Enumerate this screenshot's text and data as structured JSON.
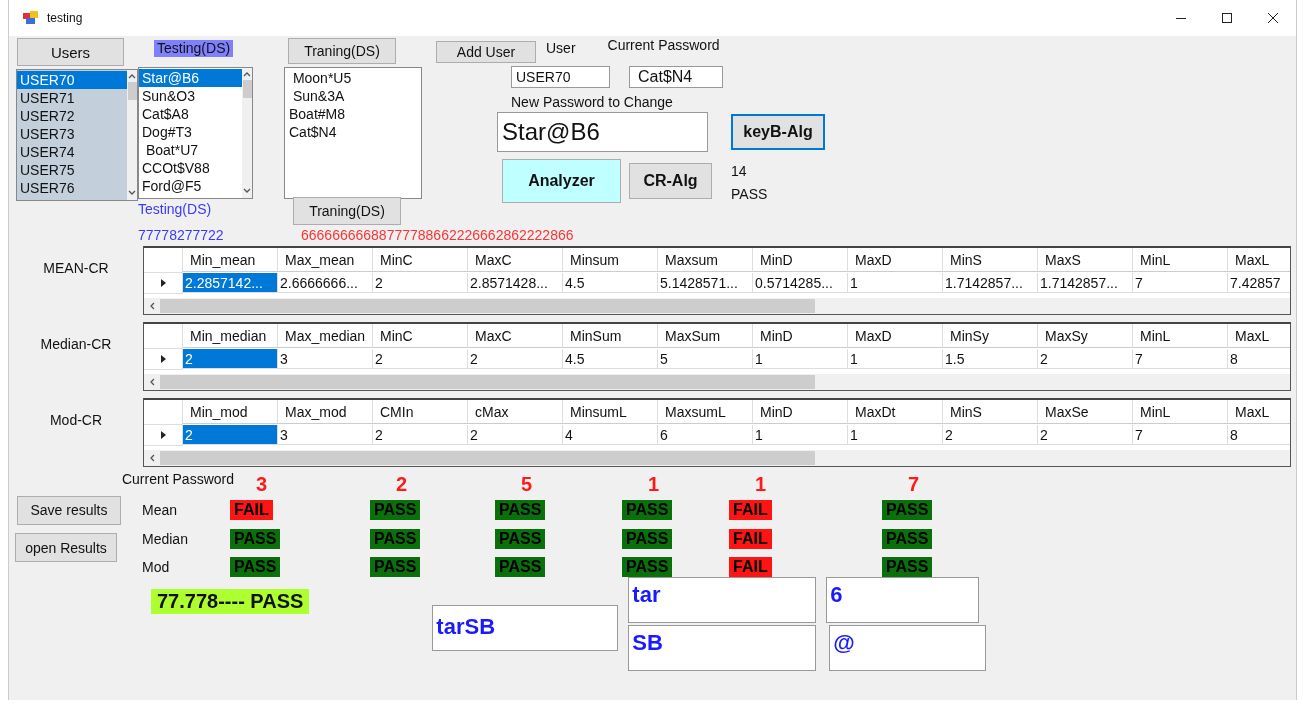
{
  "window": {
    "title": "testing"
  },
  "users_button": "Users",
  "users_list": [
    {
      "label": "USER70",
      "selected": true
    },
    {
      "label": "USER71",
      "selected": false
    },
    {
      "label": "USER72",
      "selected": false
    },
    {
      "label": "USER73",
      "selected": false
    },
    {
      "label": "USER74",
      "selected": false
    },
    {
      "label": "USER75",
      "selected": false
    },
    {
      "label": "USER76",
      "selected": false
    }
  ],
  "testing_heading": "Testing(DS)",
  "testing_list": [
    {
      "label": "Star@B6",
      "selected": true
    },
    {
      "label": "Sun&O3",
      "selected": false
    },
    {
      "label": "Cat$A8",
      "selected": false
    },
    {
      "label": "Dog#T3",
      "selected": false
    },
    {
      "label": " Boat*U7",
      "selected": false
    },
    {
      "label": "CCOt$V88",
      "selected": false
    },
    {
      "label": "Ford@F5",
      "selected": false
    }
  ],
  "training_button": "Traning(DS)",
  "training_list": [
    {
      "label": " Moon*U5",
      "selected": false
    },
    {
      "label": " Sun&3A",
      "selected": false
    },
    {
      "label": "Boat#M8",
      "selected": false
    },
    {
      "label": "Cat$N4",
      "selected": false
    }
  ],
  "testing_caption": "Testing(DS)",
  "training_button_lower": "Traning(DS)",
  "testing_code": "77778277722",
  "training_code": "66666666688777788662226662862222866",
  "add_user_button": "Add User",
  "user_label": "User",
  "current_password_label": "Current Password",
  "user_field": "USER70",
  "current_password_field": "Cat$N4",
  "new_password_label": "New Password to Change",
  "new_password_field": "Star@B6",
  "keyb_button": {
    "label": "keyB-Alg",
    "focused": true
  },
  "analyzer_button": "Analyzer",
  "cr_button": "CR-Alg",
  "length": "14",
  "verdict": "PASS",
  "grids": [
    {
      "label": "MEAN-CR",
      "columns": [
        "Min_mean",
        "Max_mean",
        "MinC",
        "MaxC",
        "Minsum",
        "Maxsum",
        "MinD",
        "MaxD",
        "MinS",
        "MaxS",
        "MinL",
        "MaxL"
      ],
      "cells": [
        {
          "text": "2.2857142...",
          "selected": true
        },
        {
          "text": "2.6666666...",
          "selected": false
        },
        {
          "text": "2",
          "selected": false
        },
        {
          "text": "2.8571428...",
          "selected": false
        },
        {
          "text": "4.5",
          "selected": false
        },
        {
          "text": "5.1428571...",
          "selected": false
        },
        {
          "text": "0.5714285...",
          "selected": false
        },
        {
          "text": "1",
          "selected": false
        },
        {
          "text": "1.7142857...",
          "selected": false
        },
        {
          "text": "1.7142857...",
          "selected": false
        },
        {
          "text": "7",
          "selected": false
        },
        {
          "text": "7.42857",
          "selected": false
        }
      ]
    },
    {
      "label": "Median-CR",
      "columns": [
        "Min_median",
        "Max_median",
        "MinC",
        "MaxC",
        "MinSum",
        "MaxSum",
        "MinD",
        "MaxD",
        "MinSy",
        "MaxSy",
        "MinL",
        "MaxL"
      ],
      "cells": [
        {
          "text": "2",
          "selected": true
        },
        {
          "text": "3",
          "selected": false
        },
        {
          "text": "2",
          "selected": false
        },
        {
          "text": "2",
          "selected": false
        },
        {
          "text": "4.5",
          "selected": false
        },
        {
          "text": "5",
          "selected": false
        },
        {
          "text": "1",
          "selected": false
        },
        {
          "text": "1",
          "selected": false
        },
        {
          "text": "1.5",
          "selected": false
        },
        {
          "text": "2",
          "selected": false
        },
        {
          "text": "7",
          "selected": false
        },
        {
          "text": "8",
          "selected": false
        }
      ]
    },
    {
      "label": "Mod-CR",
      "columns": [
        "Min_mod",
        "Max_mod",
        "CMIn",
        "cMax",
        "MinsumL",
        "MaxsumL",
        "MinD",
        "MaxDt",
        "MinS",
        "MaxSe",
        "MinL",
        "MaxL"
      ],
      "cells": [
        {
          "text": "2",
          "selected": true
        },
        {
          "text": "3",
          "selected": false
        },
        {
          "text": "2",
          "selected": false
        },
        {
          "text": "2",
          "selected": false
        },
        {
          "text": "4",
          "selected": false
        },
        {
          "text": "6",
          "selected": false
        },
        {
          "text": "1",
          "selected": false
        },
        {
          "text": "1",
          "selected": false
        },
        {
          "text": "2",
          "selected": false
        },
        {
          "text": "2",
          "selected": false
        },
        {
          "text": "7",
          "selected": false
        },
        {
          "text": "8",
          "selected": false
        }
      ]
    }
  ],
  "results": {
    "label": "Current Password",
    "rows": [
      "Mean",
      "Median",
      "Mod"
    ],
    "columns": [
      {
        "count": "3",
        "badges": [
          {
            "text": "FAIL",
            "passed": false
          },
          {
            "text": "PASS",
            "passed": true
          },
          {
            "text": "PASS",
            "passed": true
          }
        ]
      },
      {
        "count": "2",
        "badges": [
          {
            "text": "PASS",
            "passed": true
          },
          {
            "text": "PASS",
            "passed": true
          },
          {
            "text": "PASS",
            "passed": true
          }
        ]
      },
      {
        "count": "5",
        "badges": [
          {
            "text": "PASS",
            "passed": true
          },
          {
            "text": "PASS",
            "passed": true
          },
          {
            "text": "PASS",
            "passed": true
          }
        ]
      },
      {
        "count": "1",
        "badges": [
          {
            "text": "PASS",
            "passed": true
          },
          {
            "text": "PASS",
            "passed": true
          },
          {
            "text": "PASS",
            "passed": true
          }
        ]
      },
      {
        "count": "1",
        "badges": [
          {
            "text": "FAIL",
            "passed": false
          },
          {
            "text": "FAIL",
            "passed": false
          },
          {
            "text": "FAIL",
            "passed": false
          }
        ]
      },
      {
        "count": "7",
        "badges": [
          {
            "text": "PASS",
            "passed": true
          },
          {
            "text": "PASS",
            "passed": true
          },
          {
            "text": "PASS",
            "passed": true
          }
        ]
      }
    ]
  },
  "save_button": "Save results",
  "open_button": "open Results",
  "score": "77.778---- PASS",
  "fields": {
    "combined": "tarSB",
    "letters": "tar",
    "upper": "SB",
    "digit": "6",
    "symbol": "@"
  }
}
